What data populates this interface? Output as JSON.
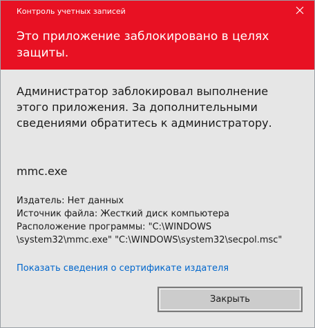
{
  "window": {
    "title": "Контроль учетных записей"
  },
  "header": {
    "text": "Это приложение заблокировано в целях защиты."
  },
  "content": {
    "message": "Администратор заблокировал выполнение этого приложения. За дополнительными сведениями обратитесь к администратору.",
    "app_name": "mmc.exe",
    "publisher": "Издатель: Нет данных",
    "file_source": "Источник файла: Жесткий диск компьютера",
    "program_location_line1": "Расположение программы: \"C:\\WINDOWS",
    "program_location_line2": "\\system32\\mmc.exe\" \"C:\\WINDOWS\\system32\\secpol.msc\""
  },
  "links": {
    "certificate": "Показать сведения о сертификате издателя"
  },
  "buttons": {
    "close_label": "Закрыть"
  },
  "colors": {
    "accent_red": "#e81123",
    "link_blue": "#0066cc",
    "background": "#e6e6e6"
  },
  "icons": {
    "close": "close-icon"
  }
}
